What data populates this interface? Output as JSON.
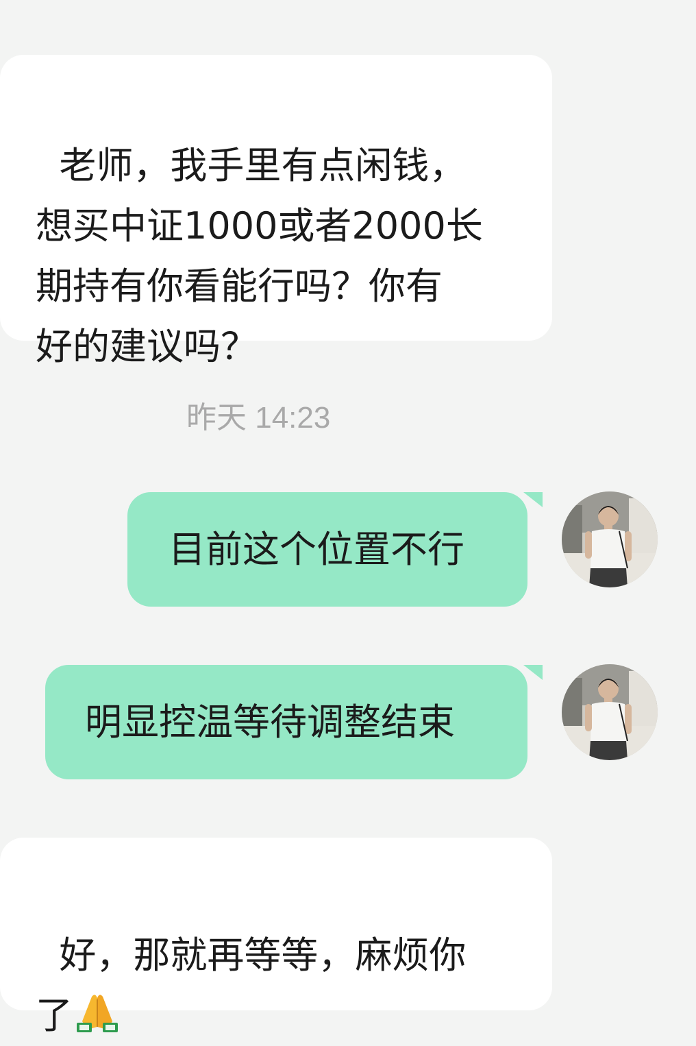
{
  "messages": [
    {
      "side": "incoming",
      "text": "老师，我手里有点闲钱，\n想买中证1000或者2000长\n期持有你看能行吗？你有\n好的建议吗？"
    },
    {
      "side": "timestamp",
      "text": "昨天 14:23"
    },
    {
      "side": "outgoing",
      "text": "目前这个位置不行"
    },
    {
      "side": "outgoing",
      "text": "明显控温等待调整结束"
    },
    {
      "side": "incoming",
      "text": "好，那就再等等，麻烦你\n了",
      "emoji": "folded-hands"
    }
  ],
  "colors": {
    "background": "#f3f4f3",
    "incoming_bubble": "#ffffff",
    "outgoing_bubble": "#95e8c6",
    "timestamp": "#a9a9a9"
  },
  "icons": {
    "avatar": "user-avatar-photo",
    "emoji": "folded-hands-emoji"
  }
}
